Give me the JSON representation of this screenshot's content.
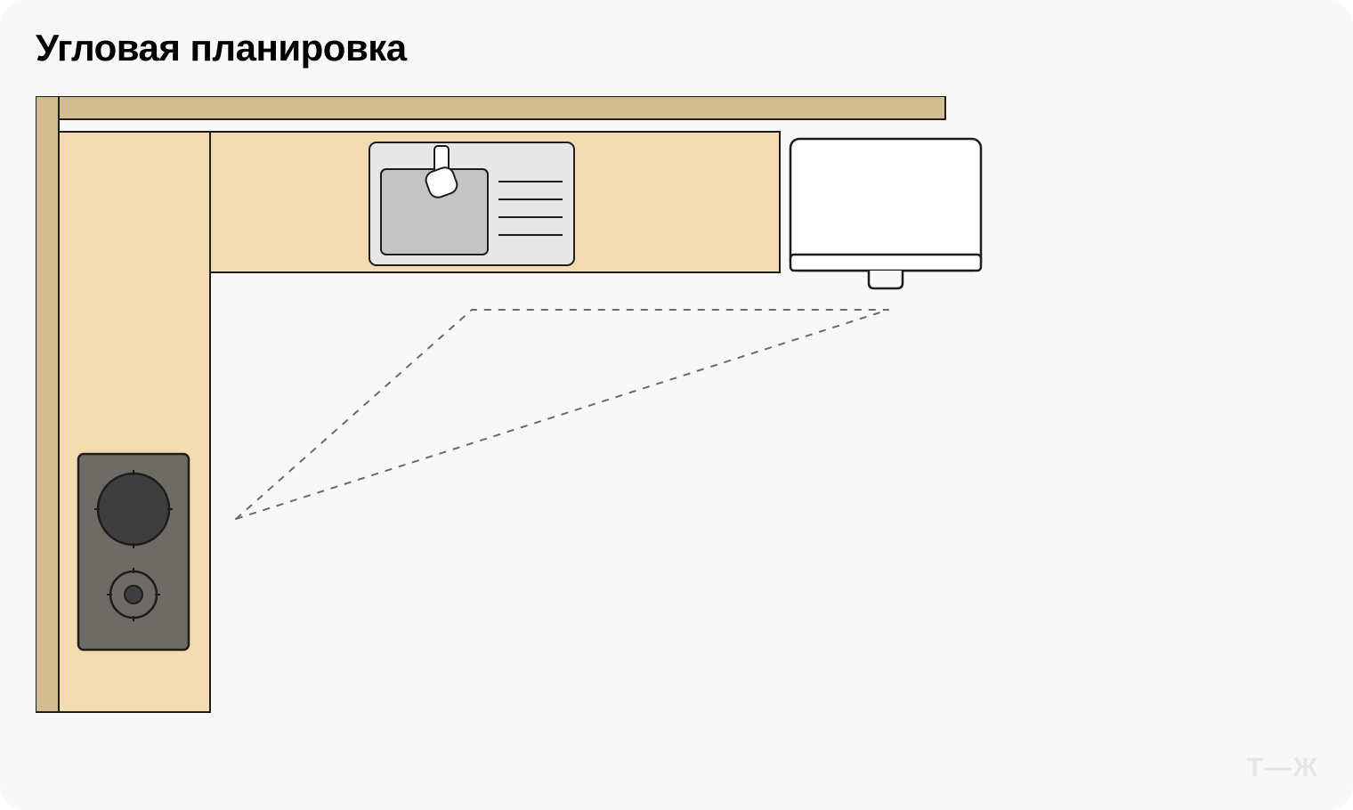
{
  "title": "Угловая планировка",
  "watermark": "Т—Ж",
  "colors": {
    "bg": "#f8f8f8",
    "wall": "#d1bd8f",
    "counter": "#f2dbb0",
    "sinkOuter": "#e7e7e7",
    "sinkInner": "#c4c4c4",
    "hobBody": "#6e6a64",
    "hobBurner": "#3f3e3c",
    "stroke": "#1d1d1d",
    "dash": "#6b6b6b",
    "white": "#ffffff"
  },
  "diagram": {
    "type": "L-shaped kitchen layout",
    "elements": [
      "back-wall",
      "side-wall",
      "countertop-horizontal",
      "countertop-vertical",
      "sink",
      "fridge",
      "hob",
      "work-triangle"
    ]
  }
}
